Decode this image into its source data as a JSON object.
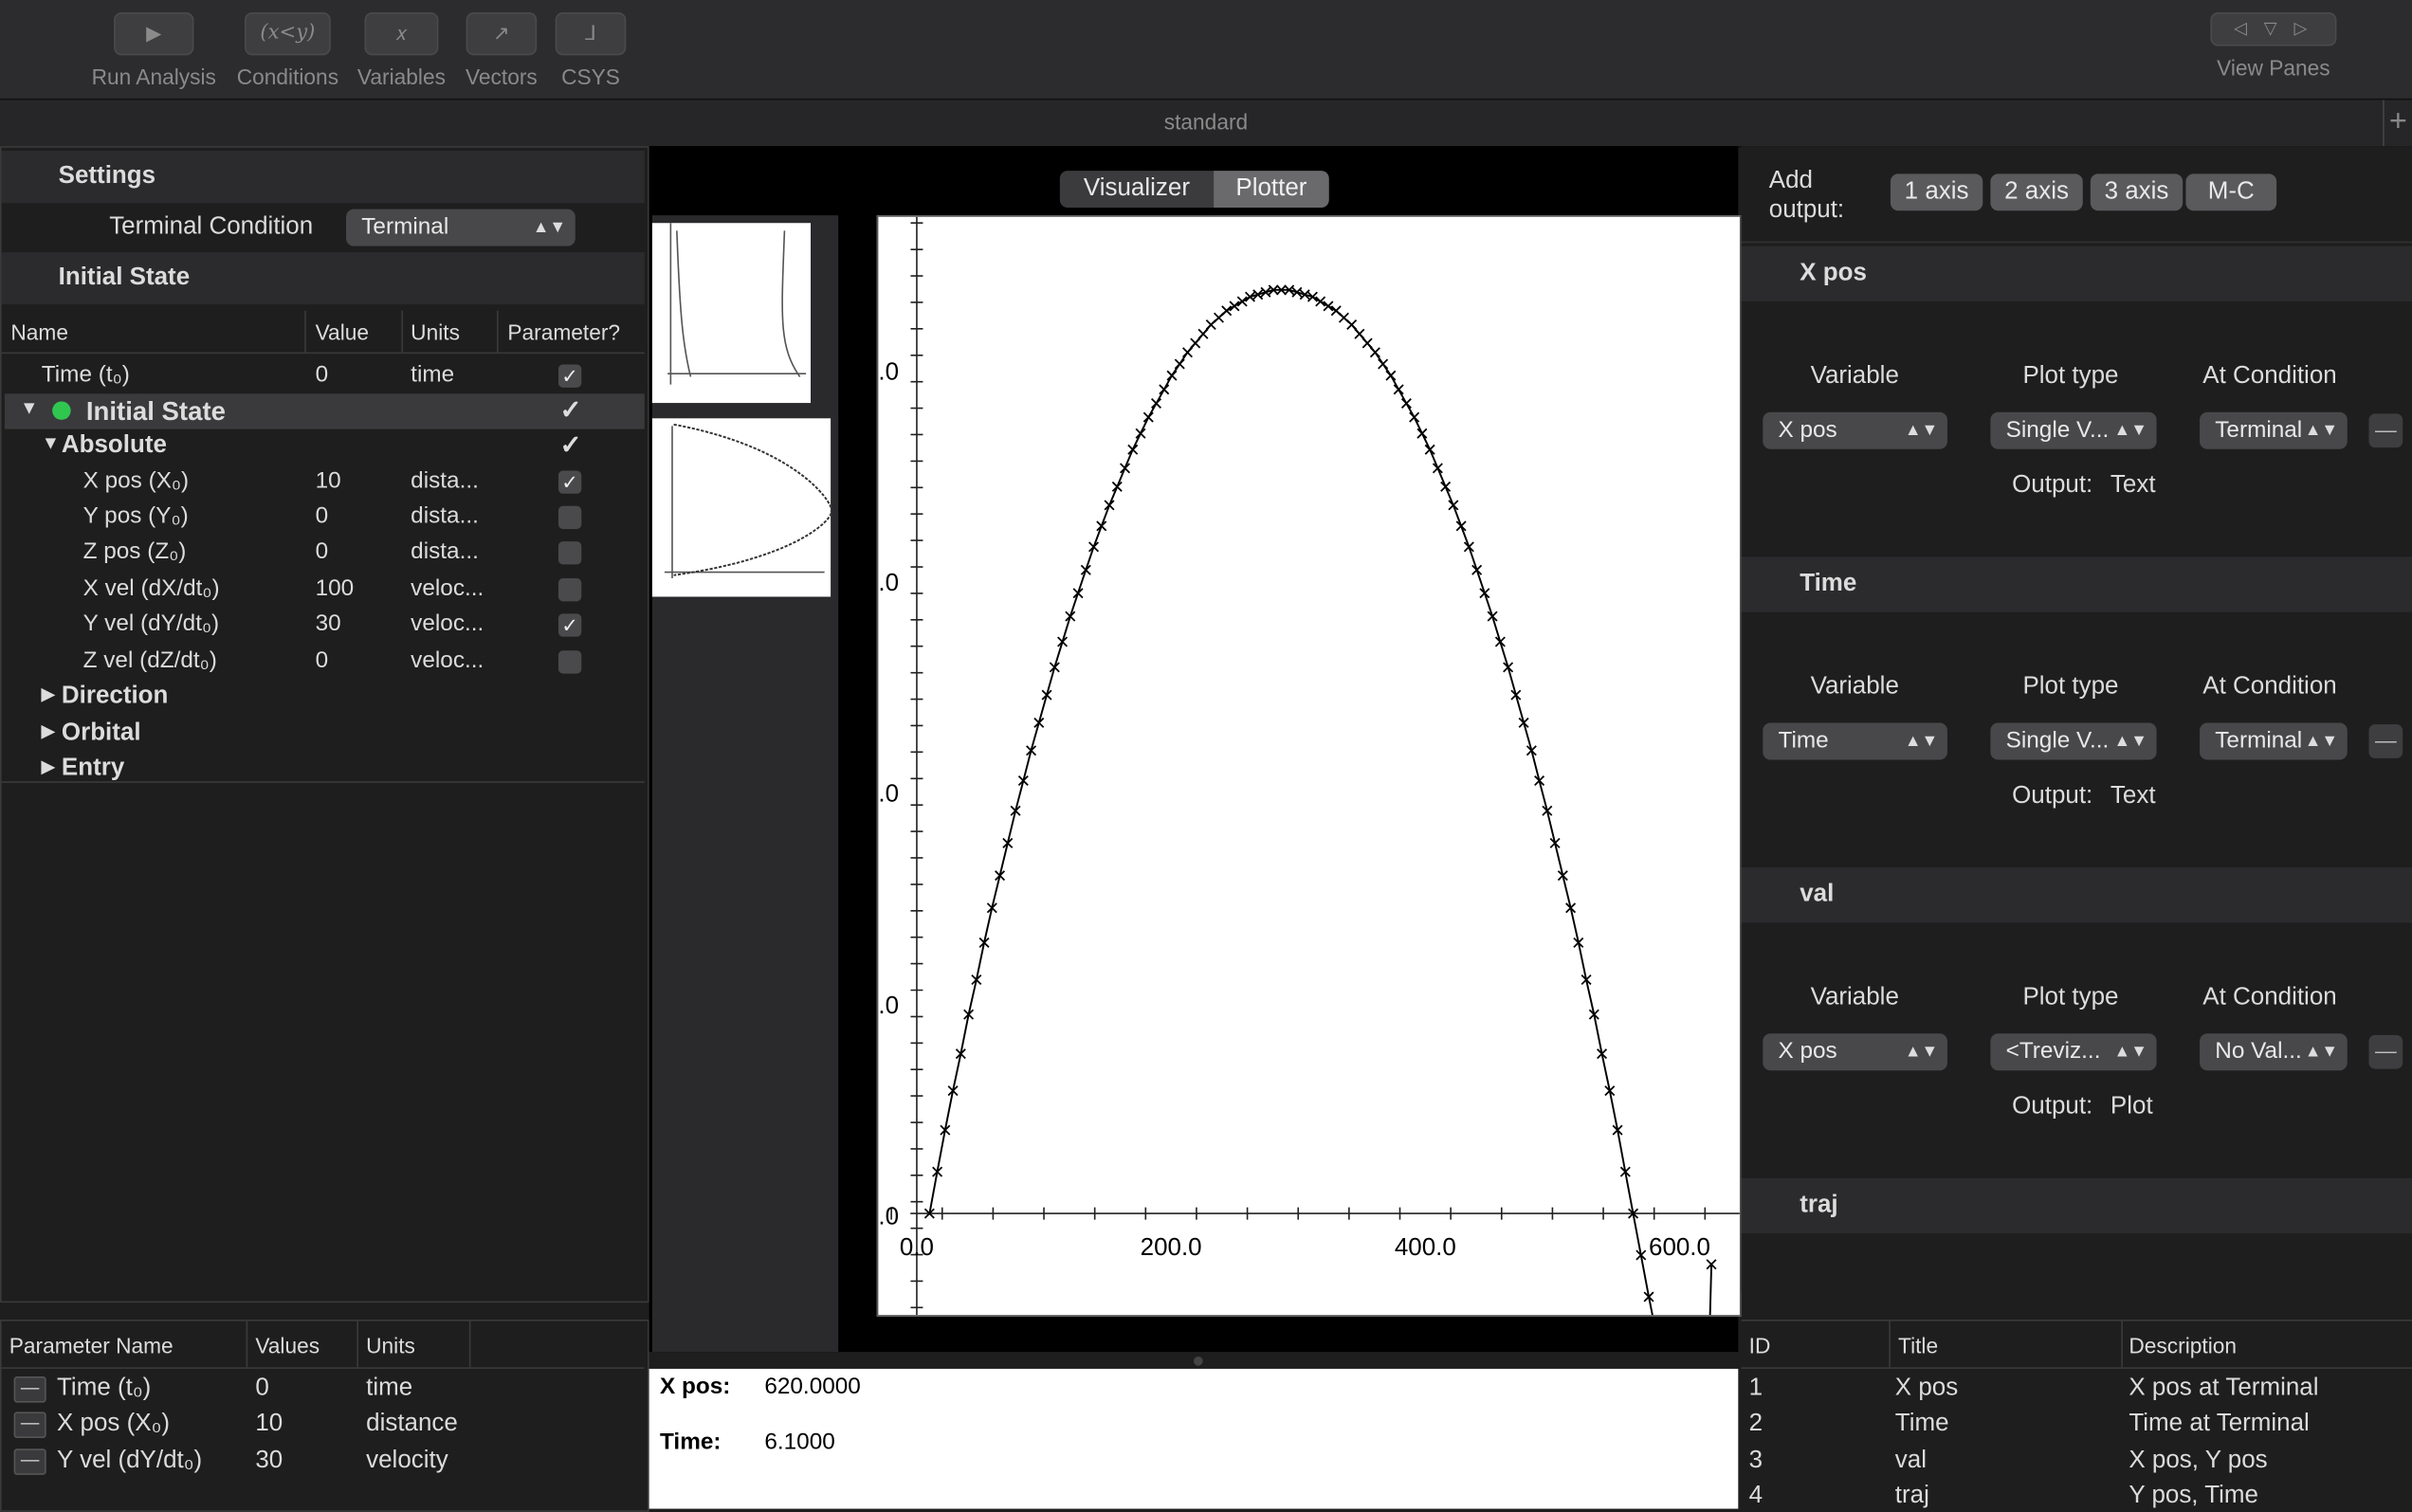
{
  "toolbar": {
    "buttons": [
      {
        "label": "Run Analysis",
        "glyph": "▶"
      },
      {
        "label": "Conditions",
        "glyph": "(x<y)"
      },
      {
        "label": "Variables",
        "glyph": "𝑥"
      },
      {
        "label": "Vectors",
        "glyph": "↗"
      },
      {
        "label": "CSYS",
        "glyph": "⅃"
      }
    ],
    "view_panes": {
      "label": "View Panes",
      "glyphs": "◁ ▽ ▷"
    }
  },
  "tab_bar": {
    "title": "standard",
    "add": "+"
  },
  "settings": {
    "header": "Settings",
    "terminal_condition_label": "Terminal Condition",
    "terminal_condition_value": "Terminal"
  },
  "initial_state": {
    "header": "Initial State",
    "columns": [
      "Name",
      "Value",
      "Units",
      "Parameter?"
    ],
    "rows": [
      {
        "name": "Time (t₀)",
        "value": "0",
        "units": "time",
        "param": true
      },
      {
        "name": "Initial State",
        "value": "",
        "units": "",
        "param": true
      },
      {
        "name": "Absolute",
        "value": "",
        "units": "",
        "param": true
      },
      {
        "name": "X pos (X₀)",
        "value": "10",
        "units": "dista...",
        "param": true
      },
      {
        "name": "Y pos (Y₀)",
        "value": "0",
        "units": "dista...",
        "param": false
      },
      {
        "name": "Z pos (Z₀)",
        "value": "0",
        "units": "dista...",
        "param": false
      },
      {
        "name": "X vel (dX/dt₀)",
        "value": "100",
        "units": "veloc...",
        "param": false
      },
      {
        "name": "Y vel (dY/dt₀)",
        "value": "30",
        "units": "veloc...",
        "param": true
      },
      {
        "name": "Z vel (dZ/dt₀)",
        "value": "0",
        "units": "veloc...",
        "param": false
      },
      {
        "name": "Direction"
      },
      {
        "name": "Orbital"
      },
      {
        "name": "Entry"
      }
    ]
  },
  "params_table": {
    "columns": [
      "Parameter Name",
      "Values",
      "Units"
    ],
    "rows": [
      {
        "name": "Time (t₀)",
        "value": "0",
        "units": "time"
      },
      {
        "name": "X pos (X₀)",
        "value": "10",
        "units": "distance"
      },
      {
        "name": "Y vel (dY/dt₀)",
        "value": "30",
        "units": "velocity"
      }
    ]
  },
  "center": {
    "segments": [
      "Visualizer",
      "Plotter"
    ],
    "selected_segment": "Plotter"
  },
  "readout": {
    "xpos_label": "X pos:",
    "xpos_value": "620.0000",
    "time_label": "Time:",
    "time_value": "6.1000"
  },
  "output_panel": {
    "add_label": "Add\noutput:",
    "add_buttons": [
      "1 axis",
      "2 axis",
      "3 axis",
      "M-C"
    ],
    "column_labels": {
      "variable": "Variable",
      "plot_type": "Plot type",
      "at_condition": "At Condition"
    },
    "cards": [
      {
        "title": "X pos",
        "variable": "X pos",
        "plot_type": "Single V...",
        "condition": "Terminal",
        "output_label": "Output:",
        "output_value": "Text"
      },
      {
        "title": "Time",
        "variable": "Time",
        "plot_type": "Single V...",
        "condition": "Terminal",
        "output_label": "Output:",
        "output_value": "Text"
      },
      {
        "title": "val",
        "variable": "X pos",
        "plot_type": "<Treviz...",
        "condition": "No Val...",
        "output_label": "Output:",
        "output_value": "Plot"
      },
      {
        "title": "traj"
      }
    ]
  },
  "outputs_table": {
    "columns": [
      "ID",
      "Title",
      "Description"
    ],
    "rows": [
      {
        "id": "1",
        "title": "X pos",
        "description": "X pos at Terminal"
      },
      {
        "id": "2",
        "title": "Time",
        "description": "Time at Terminal"
      },
      {
        "id": "3",
        "title": "val",
        "description": "X pos, Y pos"
      },
      {
        "id": "4",
        "title": "traj",
        "description": "Y pos, Time"
      }
    ]
  },
  "chart_data": {
    "type": "line",
    "marker": "x",
    "x_tick_labels": [
      "0.0",
      "200.0",
      "400.0",
      "600.0"
    ],
    "y_tick_labels": [
      ".0",
      ".0",
      ".0",
      ".0",
      ".0"
    ],
    "xlim": [
      0,
      640
    ],
    "series": [
      {
        "x": [
          10,
          16.15,
          22.3,
          28.45,
          34.6,
          40.75,
          46.9,
          53.05,
          59.2,
          65.35,
          71.5,
          77.65,
          83.8,
          89.95,
          96.1,
          102.25,
          108.4,
          114.55,
          120.7,
          126.85,
          133,
          139.15,
          145.3,
          151.45,
          157.6,
          163.75,
          169.9,
          176.05,
          182.2,
          188.35,
          194.5,
          200.65,
          206.8,
          212.95,
          219.1,
          225.25,
          231.4,
          237.55,
          243.7,
          249.85,
          256,
          262.15,
          268.3,
          274.45,
          280.6,
          286.75,
          292.9,
          299.05,
          305.2,
          311.35,
          317.5,
          323.65,
          329.8,
          335.95,
          342.1,
          348.25,
          354.4,
          360.55,
          366.7,
          372.85,
          379,
          385.15,
          391.3,
          397.45,
          403.6,
          409.75,
          415.9,
          422.05,
          428.2,
          434.35,
          440.5,
          446.65,
          452.8,
          458.95,
          465.1,
          471.25,
          477.4,
          483.55,
          489.7,
          495.85,
          502,
          508.15,
          514.3,
          520.45,
          526.6,
          532.75,
          538.9,
          545.05,
          551.2,
          557.35,
          563.5,
          569.65,
          575.8,
          581.95,
          588.1,
          594.25,
          600.4,
          606.55,
          612.7,
          618.85,
          625
        ],
        "y": [
          0,
          1.8,
          3.6,
          5.3,
          6.9,
          8.6,
          10.1,
          11.7,
          13.2,
          14.6,
          16.0,
          17.4,
          18.7,
          20.0,
          21.2,
          22.4,
          23.6,
          24.7,
          25.8,
          26.8,
          27.8,
          28.8,
          29.7,
          30.6,
          31.4,
          32.2,
          33.0,
          33.7,
          34.4,
          35.0,
          35.6,
          36.2,
          36.7,
          37.2,
          37.6,
          38.0,
          38.4,
          38.7,
          39.0,
          39.2,
          39.4,
          39.6,
          39.7,
          39.8,
          39.9,
          39.9,
          39.9,
          39.8,
          39.7,
          39.6,
          39.4,
          39.2,
          39.0,
          38.7,
          38.4,
          38.0,
          37.6,
          37.2,
          36.7,
          36.2,
          35.6,
          35.0,
          34.4,
          33.7,
          33.0,
          32.2,
          31.4,
          30.6,
          29.7,
          28.8,
          27.8,
          26.8,
          25.8,
          24.7,
          23.6,
          22.4,
          21.2,
          20.0,
          18.7,
          17.4,
          16.0,
          14.6,
          13.2,
          11.7,
          10.1,
          8.6,
          6.9,
          5.3,
          3.6,
          1.8,
          0,
          -1.8,
          -3.6,
          -5.3,
          -6.9,
          -8.6,
          -10.1,
          -11.7,
          -13.2,
          -14.6,
          -2.2
        ]
      }
    ]
  },
  "colors": {
    "accent_green": "#30c750",
    "plot_bg": "#ffffff",
    "panel_bg": "#1e1e1e",
    "header_bg": "#2b2b2d"
  }
}
